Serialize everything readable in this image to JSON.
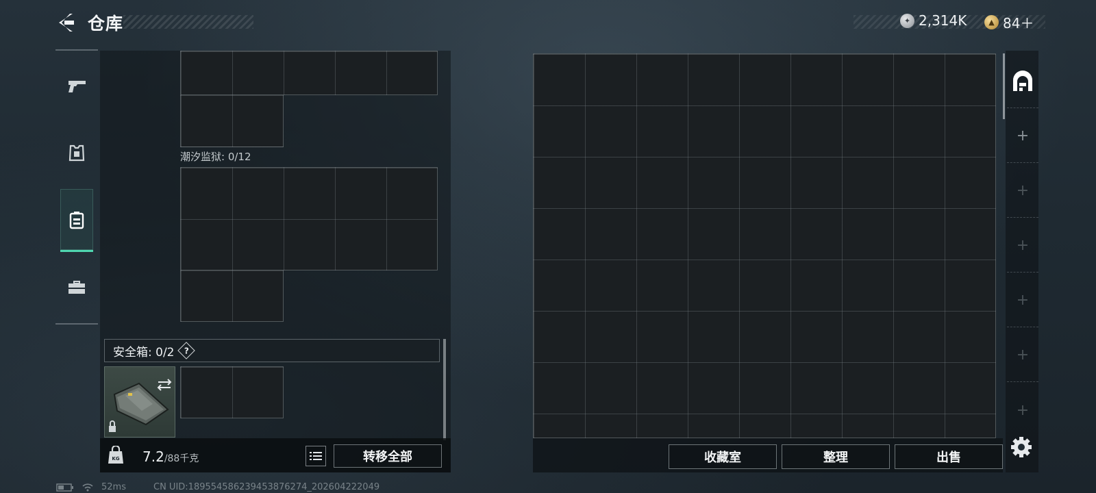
{
  "header": {
    "title": "仓库",
    "currencies": [
      {
        "icon": "silver-coin-icon",
        "value": "2,314K"
      },
      {
        "icon": "gold-coin-icon",
        "value": "84＋"
      }
    ]
  },
  "sidebar": {
    "items": [
      {
        "name": "weapon",
        "icon": "pistol-icon",
        "active": false
      },
      {
        "name": "armor",
        "icon": "armor-icon",
        "active": false
      },
      {
        "name": "backpack",
        "icon": "backpack-icon",
        "active": true
      },
      {
        "name": "toolbox",
        "icon": "toolbox-icon",
        "active": false
      }
    ]
  },
  "left_panel": {
    "container_label": "潮汐监狱: 0/12",
    "safebox_label": "安全箱: 0/2",
    "safebox_help": "?",
    "weight_current": "7.2",
    "weight_capacity": "/88千克",
    "transfer_all": "转移全部"
  },
  "right_panel": {
    "buttons": {
      "collection": "收藏室",
      "sort": "整理",
      "sell": "出售"
    },
    "tabs": [
      "warehouse-tab",
      "+",
      "+",
      "+",
      "+",
      "+",
      "+"
    ]
  },
  "status": {
    "ping": "52ms",
    "uid": "CN UID:18955458623945387627­4_202604222049"
  },
  "colors": {
    "accent": "#4fd6b0",
    "background": "#1f2a32"
  }
}
